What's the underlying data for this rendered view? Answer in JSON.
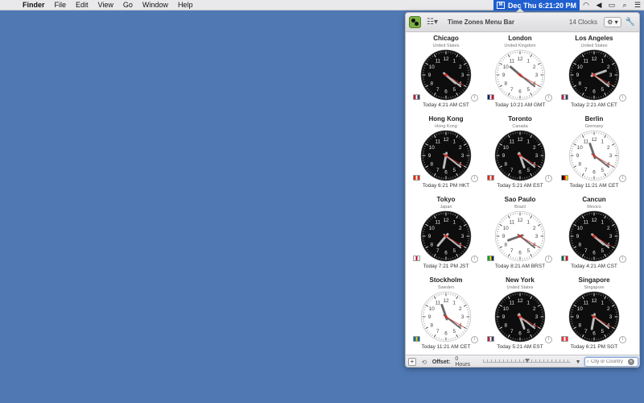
{
  "menubar": {
    "apple_glyph": "",
    "items": [
      "Finder",
      "File",
      "Edit",
      "View",
      "Go",
      "Window",
      "Help"
    ],
    "clock_text": "Dec Thu 6:21:20 PM",
    "status_icons": [
      "wifi-icon",
      "volume-icon",
      "battery-icon",
      "spotlight-icon",
      "notification-center-icon"
    ]
  },
  "window": {
    "title": "Time Zones Menu Bar",
    "clock_count": "14 Clocks",
    "gear_label": "⚙ ▾",
    "footer": {
      "add_label": "+",
      "offset_label": "Offset:",
      "offset_value": "0 Hours",
      "search_placeholder": "City or Country",
      "clear_label": "✕"
    }
  },
  "clocks": [
    {
      "city": "Chicago",
      "country": "United States",
      "time": "Today 4:21 AM CST",
      "h": 4,
      "m": 21,
      "s": 20,
      "dark": true,
      "flag": [
        "#b22234",
        "#ffffff",
        "#3c3b6e"
      ]
    },
    {
      "city": "London",
      "country": "United Kingdom",
      "time": "Today 10:21 AM GMT",
      "h": 10,
      "m": 21,
      "s": 20,
      "dark": false,
      "flag": [
        "#012169",
        "#ffffff",
        "#c8102e"
      ]
    },
    {
      "city": "Los Angeles",
      "country": "United States",
      "time": "Today 2:21 AM CET",
      "h": 2,
      "m": 21,
      "s": 20,
      "dark": true,
      "flag": [
        "#b22234",
        "#ffffff",
        "#3c3b6e"
      ]
    },
    {
      "city": "Hong Kong",
      "country": "Hong Kong",
      "time": "Today 6:21 PM HKT",
      "h": 18,
      "m": 21,
      "s": 20,
      "dark": true,
      "flag": [
        "#de2910",
        "#ffffff",
        "#de2910"
      ]
    },
    {
      "city": "Toronto",
      "country": "Canada",
      "time": "Today 5:21 AM EST",
      "h": 5,
      "m": 21,
      "s": 20,
      "dark": true,
      "flag": [
        "#d52b1e",
        "#ffffff",
        "#d52b1e"
      ]
    },
    {
      "city": "Berlin",
      "country": "Germany",
      "time": "Today 11:21 AM CET",
      "h": 11,
      "m": 21,
      "s": 20,
      "dark": false,
      "flag": [
        "#000000",
        "#dd0000",
        "#ffce00"
      ]
    },
    {
      "city": "Tokyo",
      "country": "Japan",
      "time": "Today 7:21 PM JST",
      "h": 19,
      "m": 21,
      "s": 20,
      "dark": true,
      "flag": [
        "#ffffff",
        "#bc002d",
        "#ffffff"
      ]
    },
    {
      "city": "Sao Paulo",
      "country": "Brazil",
      "time": "Today 8:21 AM BRST",
      "h": 8,
      "m": 21,
      "s": 20,
      "dark": false,
      "flag": [
        "#009b3a",
        "#fedf00",
        "#002776"
      ]
    },
    {
      "city": "Cancun",
      "country": "Mexico",
      "time": "Today 4:21 AM CST",
      "h": 4,
      "m": 21,
      "s": 20,
      "dark": true,
      "flag": [
        "#006847",
        "#ffffff",
        "#ce1126"
      ]
    },
    {
      "city": "Stockholm",
      "country": "Sweden",
      "time": "Today 11:21 AM CET",
      "h": 11,
      "m": 21,
      "s": 20,
      "dark": false,
      "flag": [
        "#006aa7",
        "#fecc00",
        "#006aa7"
      ]
    },
    {
      "city": "New York",
      "country": "United States",
      "time": "Today 5:21 AM EST",
      "h": 5,
      "m": 21,
      "s": 20,
      "dark": true,
      "flag": [
        "#b22234",
        "#ffffff",
        "#3c3b6e"
      ]
    },
    {
      "city": "Singapore",
      "country": "Singapore",
      "time": "Today 6:21 PM SGT",
      "h": 18,
      "m": 21,
      "s": 20,
      "dark": true,
      "flag": [
        "#ef3340",
        "#ffffff",
        "#ef3340"
      ]
    }
  ],
  "colors": {
    "desktop": "#5079b4",
    "menubar_highlight": "#1f5fcf",
    "second_hand": "#e0261b"
  }
}
